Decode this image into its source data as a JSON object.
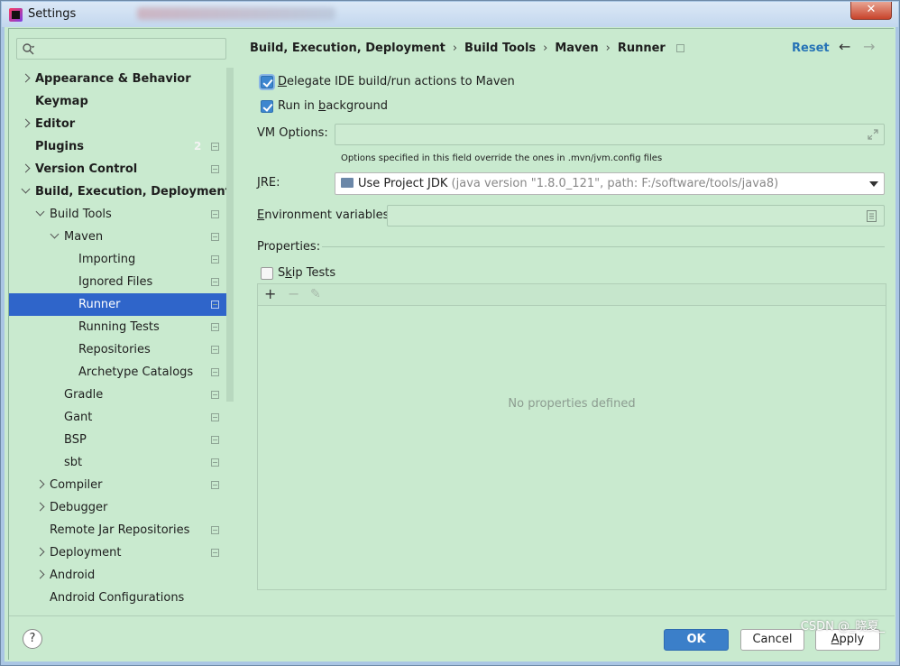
{
  "window": {
    "title": "Settings",
    "close_label": "✕"
  },
  "sidebar": {
    "search_placeholder": "",
    "items": [
      {
        "label": "Appearance & Behavior",
        "level": 0,
        "bold": true,
        "chevron": "right"
      },
      {
        "label": "Keymap",
        "level": 0,
        "bold": true
      },
      {
        "label": "Editor",
        "level": 0,
        "bold": true,
        "chevron": "right"
      },
      {
        "label": "Plugins",
        "level": 0,
        "bold": true,
        "badge": "2",
        "icon": true
      },
      {
        "label": "Version Control",
        "level": 0,
        "bold": true,
        "chevron": "right",
        "icon": true
      },
      {
        "label": "Build, Execution, Deployment",
        "level": 0,
        "bold": true,
        "chevron": "down"
      },
      {
        "label": "Build Tools",
        "level": 1,
        "chevron": "down",
        "icon": true
      },
      {
        "label": "Maven",
        "level": 2,
        "chevron": "down",
        "icon": true
      },
      {
        "label": "Importing",
        "level": 3,
        "icon": true
      },
      {
        "label": "Ignored Files",
        "level": 3,
        "icon": true
      },
      {
        "label": "Runner",
        "level": 3,
        "icon": true,
        "selected": true
      },
      {
        "label": "Running Tests",
        "level": 3,
        "icon": true
      },
      {
        "label": "Repositories",
        "level": 3,
        "icon": true
      },
      {
        "label": "Archetype Catalogs",
        "level": 3,
        "icon": true
      },
      {
        "label": "Gradle",
        "level": 2,
        "icon": true
      },
      {
        "label": "Gant",
        "level": 2,
        "icon": true
      },
      {
        "label": "BSP",
        "level": 2,
        "icon": true
      },
      {
        "label": "sbt",
        "level": 2,
        "icon": true
      },
      {
        "label": "Compiler",
        "level": 1,
        "chevron": "right",
        "icon": true
      },
      {
        "label": "Debugger",
        "level": 1,
        "chevron": "right"
      },
      {
        "label": "Remote Jar Repositories",
        "level": 1,
        "icon": true
      },
      {
        "label": "Deployment",
        "level": 1,
        "chevron": "right",
        "icon": true
      },
      {
        "label": "Android",
        "level": 1,
        "chevron": "right"
      },
      {
        "label": "Android Configurations",
        "level": 1
      }
    ]
  },
  "breadcrumb": [
    "Build, Execution, Deployment",
    "Build Tools",
    "Maven",
    "Runner"
  ],
  "breadcrumb_sep": "›",
  "header": {
    "reset_label": "Reset",
    "back_icon": "←",
    "forward_icon": "→"
  },
  "runner": {
    "delegate_pre": "D",
    "delegate_label": "elegate IDE build/run actions to Maven",
    "delegate_checked": true,
    "background_pre": "Run in ",
    "background_under": "b",
    "background_post": "ackground",
    "background_checked": true,
    "vm_options_label": "VM Options:",
    "vm_options_value": "",
    "vm_options_hint": "Options specified in this field override the ones in .mvn/jvm.config files",
    "jre_label_under": "J",
    "jre_label": "RE:",
    "jre_value": "Use Project JDK",
    "jre_detail": "(java version \"1.8.0_121\", path: F:/software/tools/java8)",
    "env_label_under": "E",
    "env_label": "nvironment variables:",
    "env_value": "",
    "properties_label": "Properties:",
    "skip_tests_pre": "S",
    "skip_tests_under": "k",
    "skip_tests_post": "ip Tests",
    "skip_tests_checked": false,
    "add_icon": "+",
    "remove_icon": "−",
    "edit_icon": "✎",
    "empty_text": "No properties defined"
  },
  "footer": {
    "help_label": "?",
    "ok_label": "OK",
    "cancel_label": "Cancel",
    "apply_pre": "",
    "apply_under": "A",
    "apply_post": "pply"
  },
  "watermark": "CSDN @_晓夏_",
  "colors": {
    "background": "#c9eacf",
    "selection": "#2f65ca",
    "link": "#2673b6",
    "primary_button": "#3b7fc9"
  }
}
